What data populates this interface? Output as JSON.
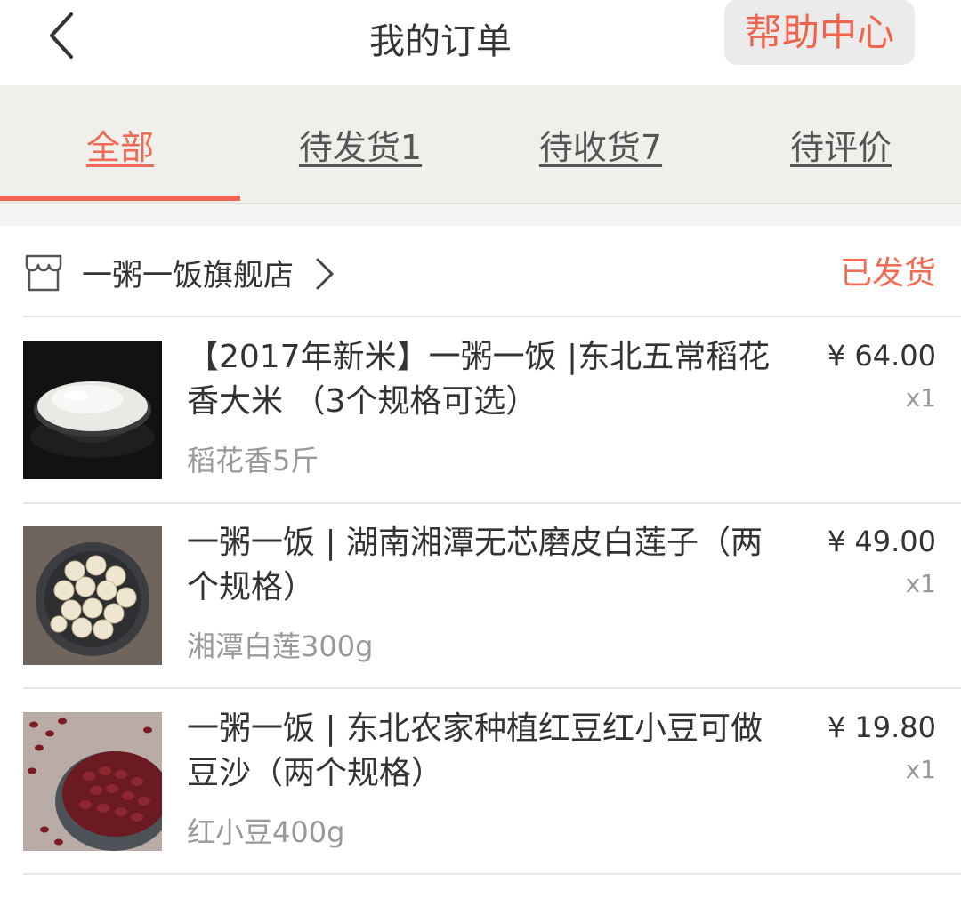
{
  "header": {
    "title": "我的订单",
    "help_label": "帮助中心"
  },
  "tabs": [
    {
      "label": "全部",
      "active": true
    },
    {
      "label": "待发货1",
      "active": false
    },
    {
      "label": "待收货7",
      "active": false
    },
    {
      "label": "待评价",
      "active": false
    }
  ],
  "store": {
    "name": "一粥一饭旗舰店",
    "status": "已发货"
  },
  "items": [
    {
      "title": "【2017年新米】一粥一饭 |东北五常稻花香大米 （3个规格可选）",
      "spec": "稻花香5斤",
      "price": "¥ 64.00",
      "qty": "x1",
      "image": "rice-bowl"
    },
    {
      "title": "一粥一饭 | 湖南湘潭无芯磨皮白莲子（两个规格）",
      "spec": "湘潭白莲300g",
      "price": "¥ 49.00",
      "qty": "x1",
      "image": "lotus-seeds-bowl"
    },
    {
      "title": "一粥一饭 | 东北农家种植红豆红小豆可做豆沙（两个规格）",
      "spec": "红小豆400g",
      "price": "¥ 19.80",
      "qty": "x1",
      "image": "red-beans-bowl"
    }
  ],
  "colors": {
    "accent": "#ef6654",
    "tab_bar_bg": "#efefeb",
    "help_bg": "#ebebeb"
  }
}
